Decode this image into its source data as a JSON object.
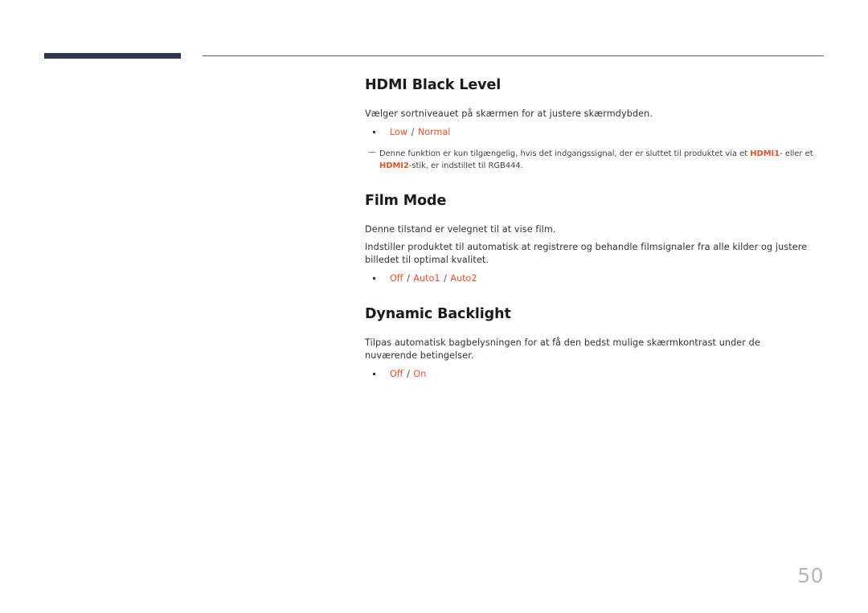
{
  "document": {
    "page_number": "50",
    "accent_color": "#e8522a",
    "header_bar_color": "#2e3652",
    "header_line_color": "#565b73"
  },
  "sections": [
    {
      "title": "HDMI Black Level",
      "paragraphs": [
        "Vælger sortniveauet på skærmen for at justere skærmdybden."
      ],
      "options": [
        {
          "value": "Low",
          "sep": "/"
        },
        {
          "value": "Normal",
          "sep": ""
        }
      ],
      "note": {
        "text_1": "Denne funktion er kun tilgængelig, hvis det indgangssignal, der er sluttet til produktet via et ",
        "hl_1": "HDMI1",
        "text_2": "- eller et ",
        "hl_2": "HDMI2",
        "text_3": "-stik, er indstillet til RGB444."
      }
    },
    {
      "title": "Film Mode",
      "paragraphs": [
        "Denne tilstand er velegnet til at vise film.",
        "Indstiller produktet til automatisk at registrere og behandle filmsignaler fra alle kilder og justere billedet til optimal kvalitet."
      ],
      "options": [
        {
          "value": "Off",
          "sep": "/"
        },
        {
          "value": "Auto1",
          "sep": "/"
        },
        {
          "value": "Auto2",
          "sep": ""
        }
      ],
      "note": null
    },
    {
      "title": "Dynamic Backlight",
      "paragraphs": [
        "Tilpas automatisk bagbelysningen for at få den bedst mulige skærmkontrast under de nuværende betingelser."
      ],
      "options": [
        {
          "value": "Off",
          "sep": "/"
        },
        {
          "value": "On",
          "sep": ""
        }
      ],
      "note": null
    }
  ]
}
